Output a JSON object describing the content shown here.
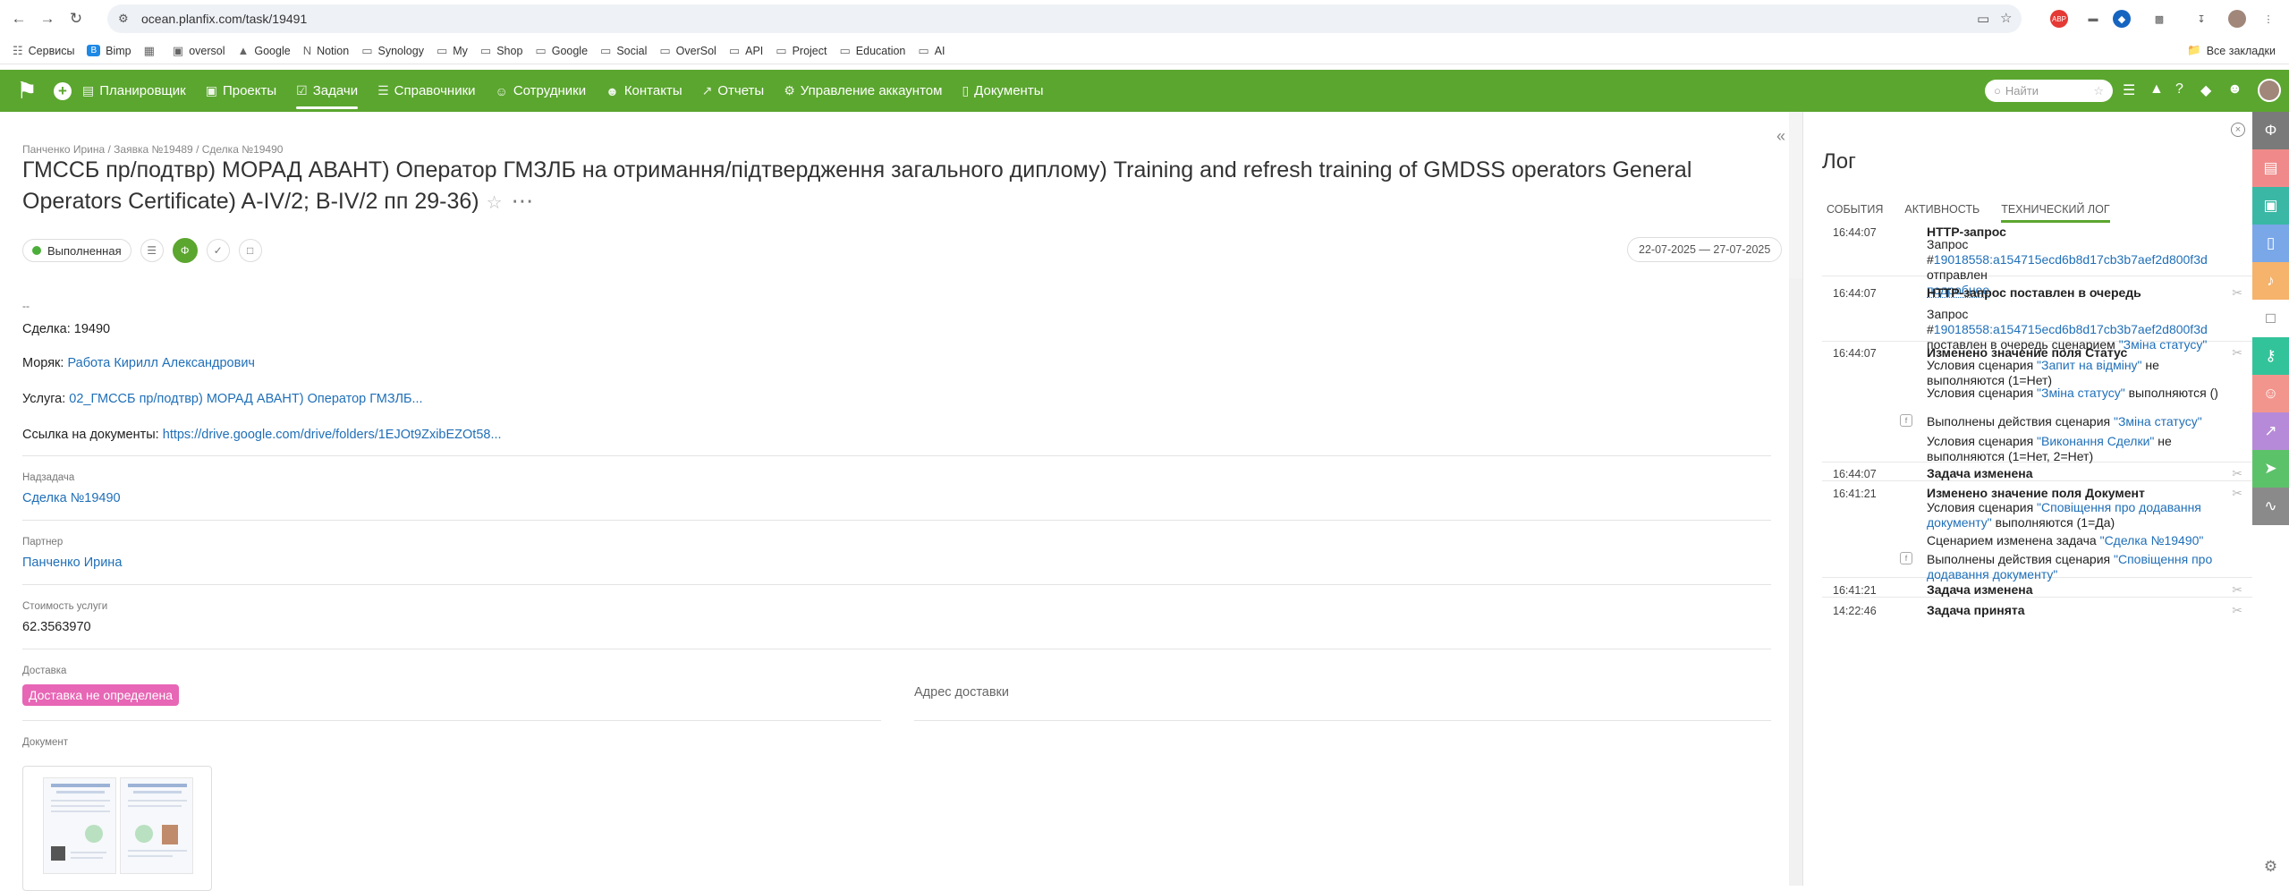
{
  "browser": {
    "url": "ocean.planfix.com/task/19491",
    "bookmarks": [
      {
        "label": "Сервисы",
        "icon": "apps-grid-icon"
      },
      {
        "label": "Bimp",
        "icon": "bimp-icon"
      },
      {
        "label": "",
        "icon": "grid-icon"
      },
      {
        "label": "oversol",
        "icon": "oversol-icon"
      },
      {
        "label": "Google",
        "icon": "google-drive-icon"
      },
      {
        "label": "Notion",
        "icon": "notion-icon"
      },
      {
        "label": "Synology",
        "icon": "folder-icon"
      },
      {
        "label": "My",
        "icon": "folder-icon"
      },
      {
        "label": "Shop",
        "icon": "folder-icon"
      },
      {
        "label": "Google",
        "icon": "folder-icon"
      },
      {
        "label": "Social",
        "icon": "folder-icon"
      },
      {
        "label": "OverSol",
        "icon": "folder-icon"
      },
      {
        "label": "API",
        "icon": "folder-icon"
      },
      {
        "label": "Project",
        "icon": "folder-icon"
      },
      {
        "label": "Education",
        "icon": "folder-icon"
      },
      {
        "label": "AI",
        "icon": "folder-icon"
      }
    ],
    "all_bookmarks": "Все закладки"
  },
  "nav": {
    "items": [
      {
        "label": "Планировщик",
        "icon": "planner-icon",
        "active": false
      },
      {
        "label": "Проекты",
        "icon": "projects-icon",
        "active": false
      },
      {
        "label": "Задачи",
        "icon": "tasks-icon",
        "active": true
      },
      {
        "label": "Справочники",
        "icon": "directories-icon",
        "active": false
      },
      {
        "label": "Сотрудники",
        "icon": "employees-icon",
        "active": false
      },
      {
        "label": "Контакты",
        "icon": "contacts-icon",
        "active": false
      },
      {
        "label": "Отчеты",
        "icon": "reports-icon",
        "active": false
      },
      {
        "label": "Управление аккаунтом",
        "icon": "account-icon",
        "active": false
      },
      {
        "label": "Документы",
        "icon": "documents-icon",
        "active": false
      }
    ],
    "search_placeholder": "Найти"
  },
  "task": {
    "breadcrumb": "Панченко Ирина / Заявка №19489 / Сделка №19490",
    "title": "ГМССБ пр/подтвр) МОРАД АВАНТ) Оператор ГМЗЛБ на отримання/підтвердження загального диплому) Training and refresh training of GMDSS operators General Operators Certificate) A-IV/2; B-IV/2 пп 29-36)",
    "status": "Выполненная",
    "dates": "22-07-2025 — 27-07-2025",
    "description": {
      "dash": "--",
      "deal_label": "Сделка:",
      "deal_value": "19490",
      "sailor_label": "Моряк:",
      "sailor_value": "Работа Кирилл Александрович",
      "service_label": "Услуга:",
      "service_value": "02_ГМССБ пр/подтвр) МОРАД АВАНТ) Оператор ГМЗЛБ...",
      "docs_label": "Ссылка на документы:",
      "docs_value": "https://drive.google.com/drive/folders/1EJOt9ZxibEZOt58..."
    },
    "fields": {
      "parent_label": "Надзадача",
      "parent_value": "Сделка №19490",
      "partner_label": "Партнер",
      "partner_value": "Панченко Ирина",
      "cost_label": "Стоимость услуги",
      "cost_value": "62.3563970",
      "delivery_label": "Доставка",
      "delivery_value": "Доставка не определена",
      "address_label": "Адрес доставки",
      "document_label": "Документ"
    }
  },
  "log": {
    "title": "Лог",
    "tabs": [
      {
        "label": "События",
        "active": false
      },
      {
        "label": "Активность",
        "active": false
      },
      {
        "label": "Технический лог",
        "active": true
      }
    ],
    "events": [
      {
        "time": "16:44:07",
        "title": "HTTP-запрос"
      },
      {
        "text": "Запрос #",
        "link": "19018558:a154715ecd6b8d17cb3b7aef2d800f3d",
        "after": " отправлен",
        "more": "подробнее"
      },
      {
        "time": "16:44:07",
        "title": "HTTP-запрос поставлен в очередь"
      },
      {
        "text": "Запрос #",
        "link": "19018558:a154715ecd6b8d17cb3b7aef2d800f3d",
        "after": " поставлен в очередь сценарием ",
        "link2": "\"Зміна статусу\""
      },
      {
        "time": "16:44:07",
        "title": "Изменено значение поля Статус"
      },
      {
        "text": "Условия сценария ",
        "link": "\"Запит на відміну\"",
        "after": " не выполняются (1=Нет)"
      },
      {
        "text": "Условия сценария ",
        "link": "\"Зміна статусу\"",
        "after": " выполняются ()"
      },
      {
        "text": "Выполнены действия сценария ",
        "link": "\"Зміна статусу\"",
        "after": ""
      },
      {
        "text": "Условия сценария ",
        "link": "\"Виконання Сделки\"",
        "after": " не выполняются (1=Нет, 2=Нет)"
      },
      {
        "time": "16:44:07",
        "title": "Задача изменена"
      },
      {
        "time": "16:41:21",
        "title": "Изменено значение поля Документ"
      },
      {
        "text": "Условия сценария ",
        "link": "\"Сповіщення про додавання документу\"",
        "after": " выполняются (1=Да)"
      },
      {
        "text": "Сценарием изменена задача ",
        "link": "\"Сделка №19490\"",
        "after": ""
      },
      {
        "text": "Выполнены действия сценария ",
        "link": "\"Сповіщення про додавання документу\"",
        "after": ""
      },
      {
        "time": "16:41:21",
        "title": "Задача изменена"
      },
      {
        "time": "14:22:46",
        "title": "Задача принята"
      }
    ]
  },
  "right_sidebar": {
    "colors": [
      "#7a7a7a",
      "#f08a8a",
      "#3ab8a5",
      "#7aa7e8",
      "#f5b36b",
      "#ffffff",
      "#33c39a",
      "#f2968d",
      "#b68ad8",
      "#5cc26a",
      "#8a8a8a"
    ]
  },
  "colors": {
    "accent_green": "#5ba62f",
    "link_blue": "#1f6fb8",
    "delivery_badge": "#e766b5"
  }
}
